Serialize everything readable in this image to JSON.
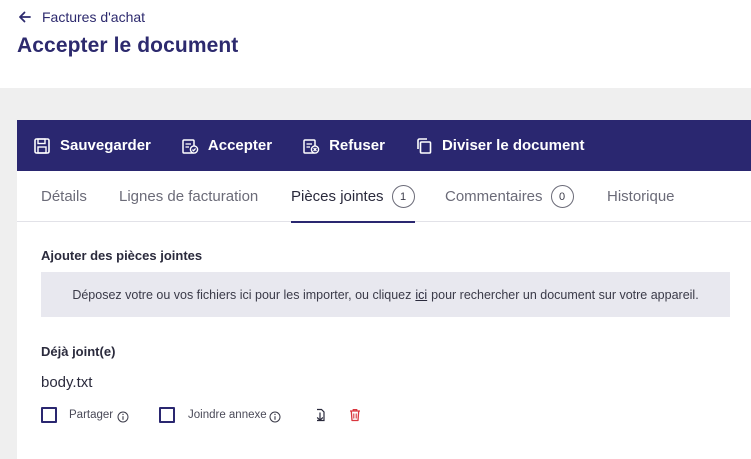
{
  "header": {
    "back_label": "Factures d'achat",
    "title": "Accepter le document"
  },
  "toolbar": {
    "save_label": "Sauvegarder",
    "accept_label": "Accepter",
    "refuse_label": "Refuser",
    "split_label": "Diviser le document"
  },
  "tabs": {
    "details": "Détails",
    "billing_lines": "Lignes de facturation",
    "attachments": "Pièces jointes",
    "attachments_count": "1",
    "comments": "Commentaires",
    "comments_count": "0",
    "history": "Historique"
  },
  "attachments": {
    "add_title": "Ajouter des pièces jointes",
    "drop_text_before": "Déposez votre ou vos fichiers ici pour les importer, ou cliquez",
    "drop_link": "ici",
    "drop_text_after": "pour rechercher un document sur votre appareil.",
    "attached_title": "Déjà joint(e)",
    "file_name": "body.txt",
    "share_label": "Partager",
    "annex_label": "Joindre annexe"
  },
  "colors": {
    "primary": "#2a2770",
    "title": "#2d2a6e",
    "delete": "#d9363e",
    "dropzone_bg": "#e8e8ef",
    "page_bg": "#efefef"
  }
}
